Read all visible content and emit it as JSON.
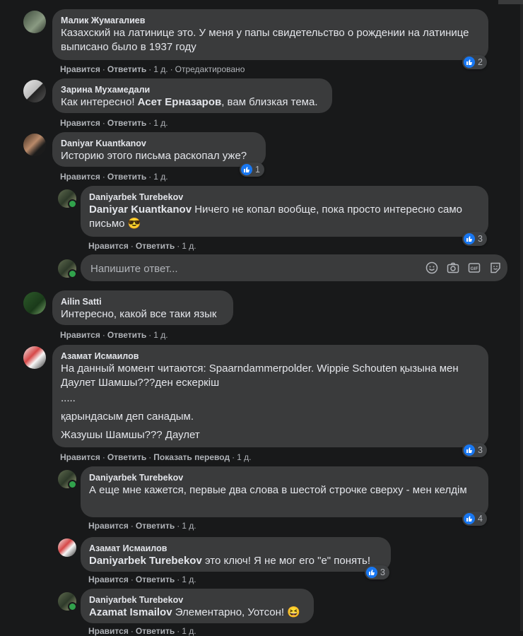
{
  "colors": {
    "background": "#18191a",
    "bubble": "#3a3b3c",
    "like_blue": "#1877f2",
    "online_green": "#31a24c",
    "secondary_text": "#b0b3b8"
  },
  "actions": {
    "like": "Нравится",
    "reply": "Ответить",
    "translate": "Показать перевод",
    "edited": "Отредактировано",
    "separator": "·"
  },
  "comments": [
    {
      "author": "Малик Жумагалиев",
      "text": "Казахский на латинице это. У меня у папы свидетельство о рождении на латинице выписано было в 1937 году",
      "time": "1 д.",
      "reactions": "2"
    },
    {
      "author": "Зарина Мухамедали",
      "text_before": "Как интересно! ",
      "mention": "Асет Ерназаров",
      "text_after": ", вам близкая тема.",
      "time": "1 д."
    },
    {
      "author": "Daniyar Kuantkanov",
      "text": "Историю этого письма раскопал уже?",
      "time": "1 д.",
      "reactions": "1"
    },
    {
      "author": "Daniyarbek Turebekov",
      "mention": "Daniyar Kuantkanov",
      "text_after": " Ничего не копал вообще, пока просто интересно само письмо 😎",
      "time": "1 д.",
      "reactions": "3"
    },
    {
      "author": "Ailin Satti",
      "text": "Интересно, какой все таки язык",
      "time": "1 д."
    },
    {
      "author": "Азамат Исмаилов",
      "line1": "На данный момент читаются: Spaarndammerpolder. Wippie Schouten қызына мен Даулет Шамшы???ден ескеркіш",
      "line2": ".....",
      "line3": "қарындасым деп санадым.",
      "line4": "Жазушы Шамшы??? Даулет",
      "time": "1 д.",
      "reactions": "3"
    },
    {
      "author": "Daniyarbek Turebekov",
      "text": "А еще мне кажется, первые два слова в шестой строчке сверху - мен келдім",
      "time": "1 д.",
      "reactions": "4"
    },
    {
      "author": "Азамат Исмаилов",
      "mention": "Daniyarbek Turebekov",
      "text_after": " это ключ! Я не мог его \"е\" понять!",
      "time": "1 д.",
      "reactions": "3"
    },
    {
      "author": "Daniyarbek Turebekov",
      "mention": "Azamat Ismailov",
      "text_after": " Элементарно, Уотсон! 😆",
      "time": "1 д."
    }
  ],
  "reply_box": {
    "placeholder": "Напишите ответ...",
    "icons": [
      "emoji-icon",
      "camera-icon",
      "gif-icon",
      "sticker-icon"
    ]
  }
}
